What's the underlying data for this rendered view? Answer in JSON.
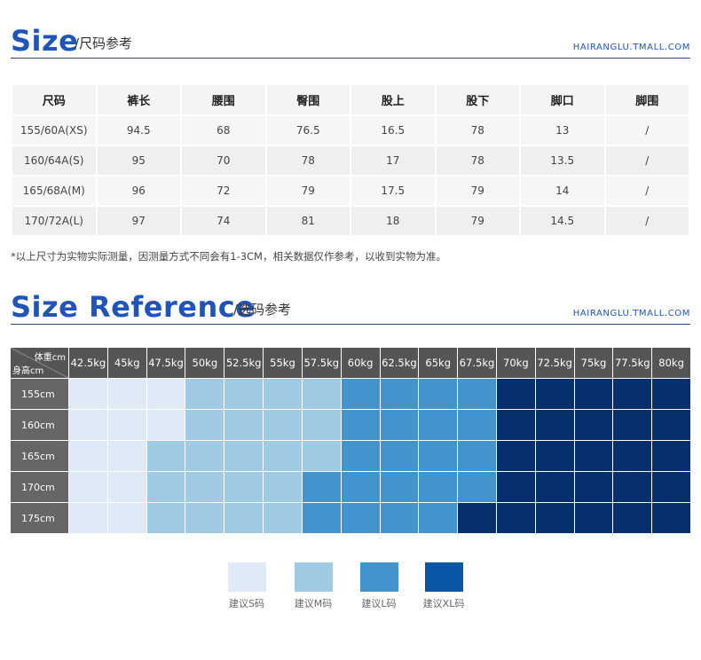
{
  "size_section": {
    "title_big": "Size",
    "title_sub": "/尺码参考",
    "url": "HAIRANGLU.TMALL.COM",
    "headers": [
      "尺码",
      "裤长",
      "腰围",
      "臀围",
      "股上",
      "股下",
      "脚口",
      "脚围"
    ],
    "rows": [
      [
        "155/60A(XS)",
        "94.5",
        "68",
        "76.5",
        "16.5",
        "78",
        "13",
        "/"
      ],
      [
        "160/64A(S)",
        "95",
        "70",
        "78",
        "17",
        "78",
        "13.5",
        "/"
      ],
      [
        "165/68A(M)",
        "96",
        "72",
        "79",
        "17.5",
        "79",
        "14",
        "/"
      ],
      [
        "170/72A(L)",
        "97",
        "74",
        "81",
        "18",
        "79",
        "14.5",
        "/"
      ]
    ],
    "note": "*以上尺寸为实物实际测量，因测量方式不同会有1-3CM，相关数据仅作参考，以收到实物为准。"
  },
  "reference_section": {
    "title_big": "Size Reference",
    "title_sub": "/选码参考",
    "url": "HAIRANGLU.TMALL.COM",
    "corner_weight": "体重cm",
    "corner_height": "身高cm",
    "weights": [
      "42.5kg",
      "45kg",
      "47.5kg",
      "50kg",
      "52.5kg",
      "55kg",
      "57.5kg",
      "60kg",
      "62.5kg",
      "65kg",
      "67.5kg",
      "70kg",
      "72.5kg",
      "75kg",
      "77.5kg",
      "80kg"
    ],
    "heights": [
      "155cm",
      "160cm",
      "165cm",
      "170cm",
      "175cm"
    ],
    "grid": [
      [
        "S",
        "S",
        "S",
        "M",
        "M",
        "M",
        "M",
        "L",
        "L",
        "L",
        "L",
        "XL",
        "XL",
        "XL",
        "XL",
        "XL"
      ],
      [
        "S",
        "S",
        "S",
        "M",
        "M",
        "M",
        "M",
        "L",
        "L",
        "L",
        "L",
        "XL",
        "XL",
        "XL",
        "XL",
        "XL"
      ],
      [
        "S",
        "S",
        "M",
        "M",
        "M",
        "M",
        "M",
        "L",
        "L",
        "L",
        "L",
        "XL",
        "XL",
        "XL",
        "XL",
        "XL"
      ],
      [
        "S",
        "S",
        "M",
        "M",
        "M",
        "M",
        "L",
        "L",
        "L",
        "L",
        "L",
        "XL",
        "XL",
        "XL",
        "XL",
        "XL"
      ],
      [
        "S",
        "S",
        "M",
        "M",
        "M",
        "M",
        "L",
        "L",
        "L",
        "L",
        "XL",
        "XL",
        "XL",
        "XL",
        "XL",
        "XL"
      ]
    ],
    "colors": {
      "S": "#deeaf7",
      "M": "#9fcae3",
      "L": "#4394cd",
      "XL": "#062f6e",
      "XL_legend": "#0b55a6"
    },
    "legend": [
      {
        "key": "S",
        "label": "建议S码"
      },
      {
        "key": "M",
        "label": "建议M码"
      },
      {
        "key": "L",
        "label": "建议L码"
      },
      {
        "key": "XL",
        "label": "建议XL码"
      }
    ]
  }
}
